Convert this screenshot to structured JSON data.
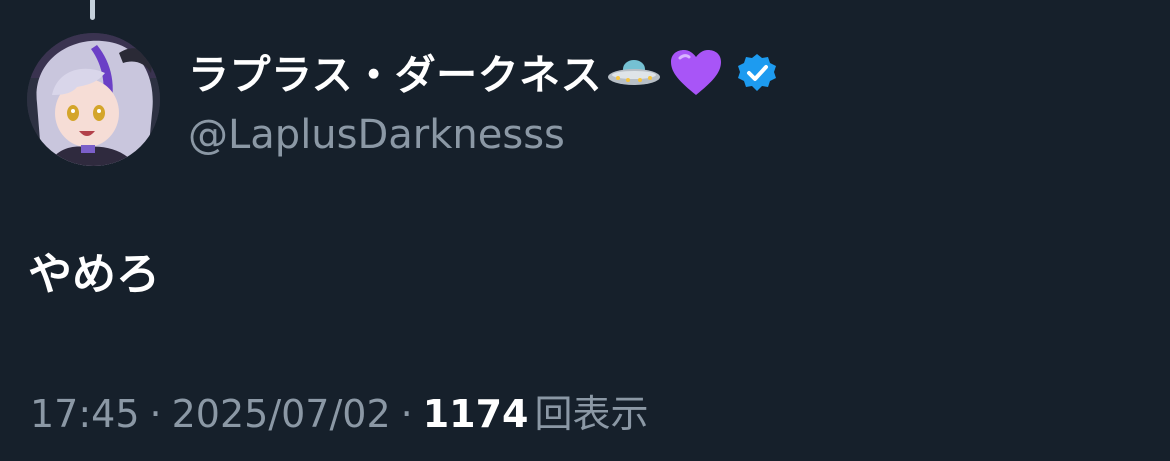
{
  "author": {
    "display_name": "ラプラス・ダークネス",
    "name_emojis": [
      "ufo-icon",
      "purple-heart-icon"
    ],
    "verified": true,
    "handle": "@LaplusDarknesss"
  },
  "tweet": {
    "text": "やめろ"
  },
  "meta": {
    "time": "17:45",
    "separator": "·",
    "date": "2025/07/02",
    "views_count": "1174",
    "views_label": "回表示"
  },
  "colors": {
    "background": "#16202b",
    "text_primary": "#ffffff",
    "text_secondary": "#8b98a5",
    "verified_badge": "#1d9bf0",
    "heart": "#a855f7"
  }
}
